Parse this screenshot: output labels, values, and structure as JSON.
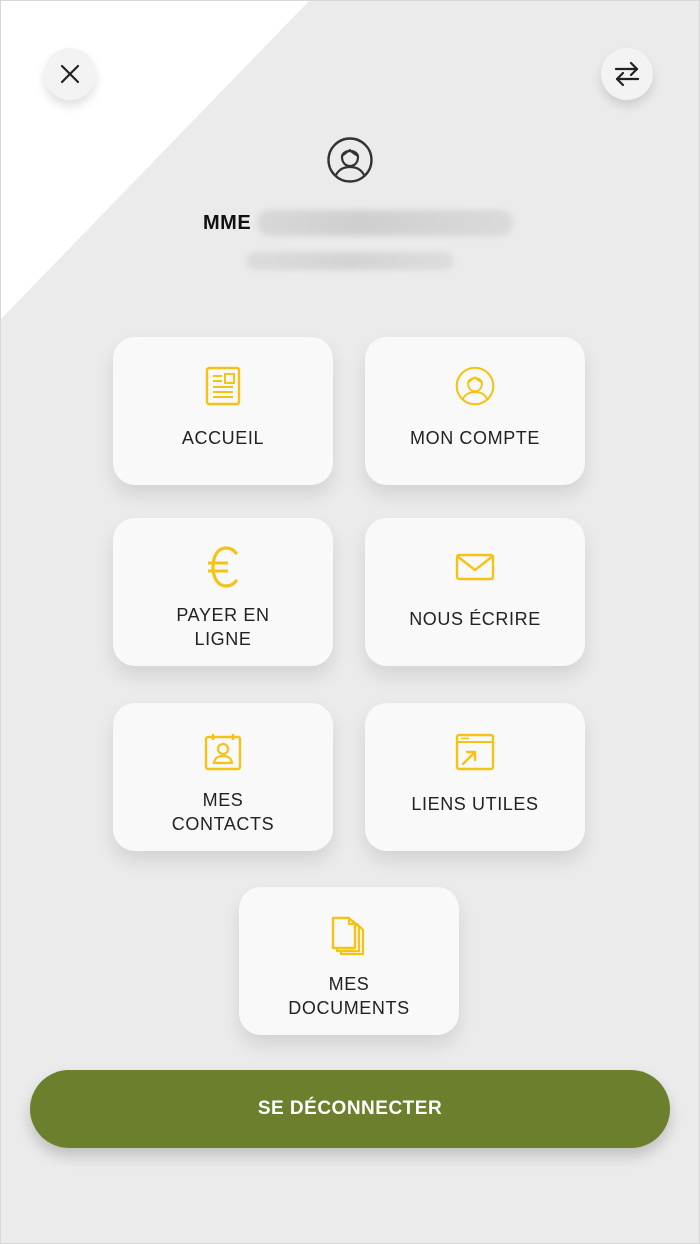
{
  "header": {
    "close_icon": "close-icon",
    "switch_icon": "switch-arrows-icon",
    "avatar_icon": "user-avatar-icon"
  },
  "user": {
    "prefix": "MME"
  },
  "menu": {
    "accueil": {
      "label": "ACCUEIL",
      "icon": "newspaper-icon"
    },
    "mon_compte": {
      "label": "MON COMPTE",
      "icon": "user-circle-icon"
    },
    "payer": {
      "label": "PAYER EN\nLIGNE",
      "icon": "euro-icon"
    },
    "ecrire": {
      "label": "NOUS ÉCRIRE",
      "icon": "envelope-icon"
    },
    "contacts": {
      "label": "MES\nCONTACTS",
      "icon": "contact-card-icon"
    },
    "liens": {
      "label": "LIENS UTILES",
      "icon": "external-link-window-icon"
    },
    "documents": {
      "label": "MES\nDOCUMENTS",
      "icon": "documents-icon"
    }
  },
  "logout": {
    "label": "SE DÉCONNECTER"
  },
  "colors": {
    "accent_icon": "#f4c313",
    "logout_button": "#6c7f2c",
    "background": "#ebebeb",
    "tile_background": "#f9f9f9"
  }
}
